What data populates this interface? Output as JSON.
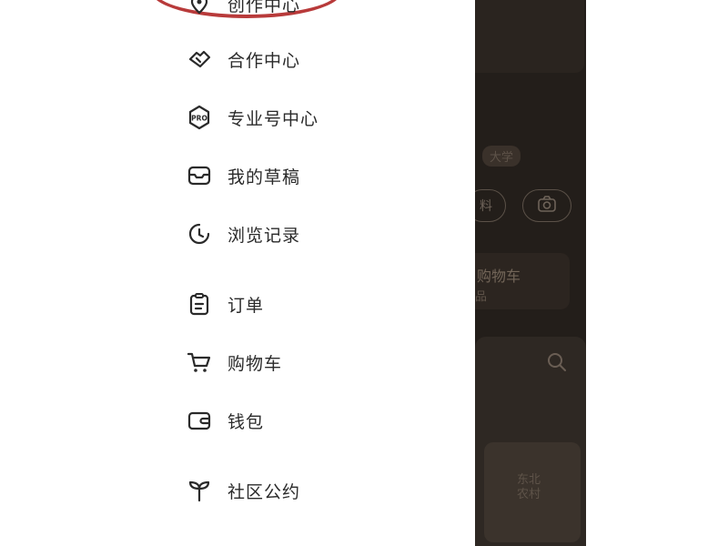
{
  "drawer": {
    "items": [
      {
        "label": "创作中心",
        "icon": "creator-center-icon"
      },
      {
        "label": "合作中心",
        "icon": "handshake-icon"
      },
      {
        "label": "专业号中心",
        "icon": "pro-badge-icon"
      },
      {
        "label": "我的草稿",
        "icon": "draft-box-icon"
      },
      {
        "label": "浏览记录",
        "icon": "history-clock-icon"
      },
      {
        "label": "订单",
        "icon": "clipboard-icon"
      },
      {
        "label": "购物车",
        "icon": "shopping-cart-icon"
      },
      {
        "label": "钱包",
        "icon": "wallet-icon"
      },
      {
        "label": "社区公约",
        "icon": "sprout-icon"
      }
    ]
  },
  "background": {
    "badge_text": "大学",
    "pill_text": "料",
    "shop_label": "购物车",
    "shop_sub": "品",
    "card_text": "东北\n农村"
  },
  "colors": {
    "highlight": "#b83a3a",
    "text": "#2a2a2a",
    "overlay": "#231e1a"
  }
}
